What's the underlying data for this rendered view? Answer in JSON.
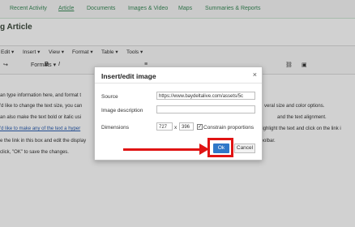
{
  "tabs": [
    {
      "label": "Recent Activity"
    },
    {
      "label": "Article"
    },
    {
      "label": "Documents"
    },
    {
      "label": "Images & Video"
    },
    {
      "label": "Maps"
    },
    {
      "label": "Summaries & Reports"
    }
  ],
  "page_title": "g Article",
  "menubar": [
    "Edit",
    "Insert",
    "View",
    "Format",
    "Table",
    "Tools"
  ],
  "toolbar": {
    "formats": "Formats",
    "bold": "B",
    "italic": "I"
  },
  "content_lines": [
    "an type information here, and format t",
    "'d like to change the text size, you can",
    "an also make the text bold or italic usi",
    "'d like to make any of the text a hyper",
    "e the link in this box and edit the display",
    "click, \"OK\" to save the changes."
  ],
  "content_right": [
    "veral size and color options.",
    "and the text alignment.",
    "highlight the text and click on the link i",
    "toolbar."
  ],
  "dialog": {
    "title": "Insert/edit image",
    "close": "×",
    "source_label": "Source",
    "source_value": "https://www.baydeltalive.com/assets/5c",
    "description_label": "Image description",
    "description_value": "",
    "dimensions_label": "Dimensions",
    "width": "727",
    "by": "x",
    "height": "396",
    "constrain_label": "Constrain proportions",
    "constrain_checked": true,
    "ok_label": "Ok",
    "cancel_label": "Cancel"
  },
  "colors": {
    "accent": "#2f77c8",
    "annotation": "#e01414",
    "tab": "#3b8b5a"
  }
}
